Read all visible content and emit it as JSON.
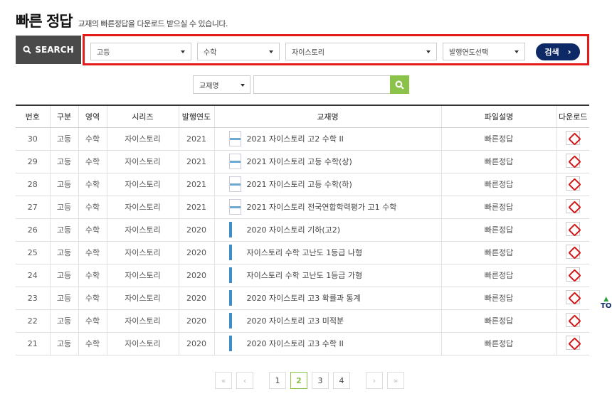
{
  "header": {
    "title": "빠른 정답",
    "subtitle": "교재의 빠른정답을 다운로드 받으실 수 있습니다."
  },
  "search": {
    "label": "SEARCH",
    "filters": [
      {
        "value": "고등"
      },
      {
        "value": "수학"
      },
      {
        "value": "자이스토리"
      },
      {
        "value": "발행연도선택"
      }
    ],
    "button": "검색",
    "book_select": "교재명",
    "book_input": ""
  },
  "table": {
    "headers": [
      "번호",
      "구분",
      "영역",
      "시리즈",
      "발행연도",
      "교재명",
      "파일설명",
      "다운로드"
    ],
    "rows": [
      {
        "no": "30",
        "type": "고등",
        "area": "수학",
        "series": "자이스토리",
        "year": "2021",
        "title": "2021 자이스토리 고2 수학 II",
        "desc": "빠른정답"
      },
      {
        "no": "29",
        "type": "고등",
        "area": "수학",
        "series": "자이스토리",
        "year": "2021",
        "title": "2021 자이스토리 고등 수학(상)",
        "desc": "빠른정답"
      },
      {
        "no": "28",
        "type": "고등",
        "area": "수학",
        "series": "자이스토리",
        "year": "2021",
        "title": "2021 자이스토리 고등 수학(하)",
        "desc": "빠른정답"
      },
      {
        "no": "27",
        "type": "고등",
        "area": "수학",
        "series": "자이스토리",
        "year": "2021",
        "title": "2021 자이스토리 전국연합학력평가 고1 수학",
        "desc": "빠른정답"
      },
      {
        "no": "26",
        "type": "고등",
        "area": "수학",
        "series": "자이스토리",
        "year": "2020",
        "title": "2020 자이스토리 기하(고2)",
        "desc": "빠른정답"
      },
      {
        "no": "25",
        "type": "고등",
        "area": "수학",
        "series": "자이스토리",
        "year": "2020",
        "title": "자이스토리 수학 고난도 1등급 나형",
        "desc": "빠른정답"
      },
      {
        "no": "24",
        "type": "고등",
        "area": "수학",
        "series": "자이스토리",
        "year": "2020",
        "title": "자이스토리 수학 고난도 1등급 가형",
        "desc": "빠른정답"
      },
      {
        "no": "23",
        "type": "고등",
        "area": "수학",
        "series": "자이스토리",
        "year": "2020",
        "title": "2020 자이스토리 고3 확률과 통계",
        "desc": "빠른정답"
      },
      {
        "no": "22",
        "type": "고등",
        "area": "수학",
        "series": "자이스토리",
        "year": "2020",
        "title": "2020 자이스토리 고3 미적분",
        "desc": "빠른정답"
      },
      {
        "no": "21",
        "type": "고등",
        "area": "수학",
        "series": "자이스토리",
        "year": "2020",
        "title": "2020 자이스토리 고3 수학 II",
        "desc": "빠른정답"
      }
    ]
  },
  "pagination": {
    "first": "«",
    "prev": "‹",
    "pages": [
      "1",
      "2",
      "3",
      "4"
    ],
    "current": "2",
    "next": "›",
    "last": "»"
  },
  "top_button": "TO",
  "icons": {
    "search": "search-icon",
    "pdf": "pdf-icon",
    "caret": "chevron-down-icon"
  },
  "colors": {
    "accent_green": "#8bc34a",
    "navy": "#0d2a66",
    "highlight": "#e31b1b"
  }
}
